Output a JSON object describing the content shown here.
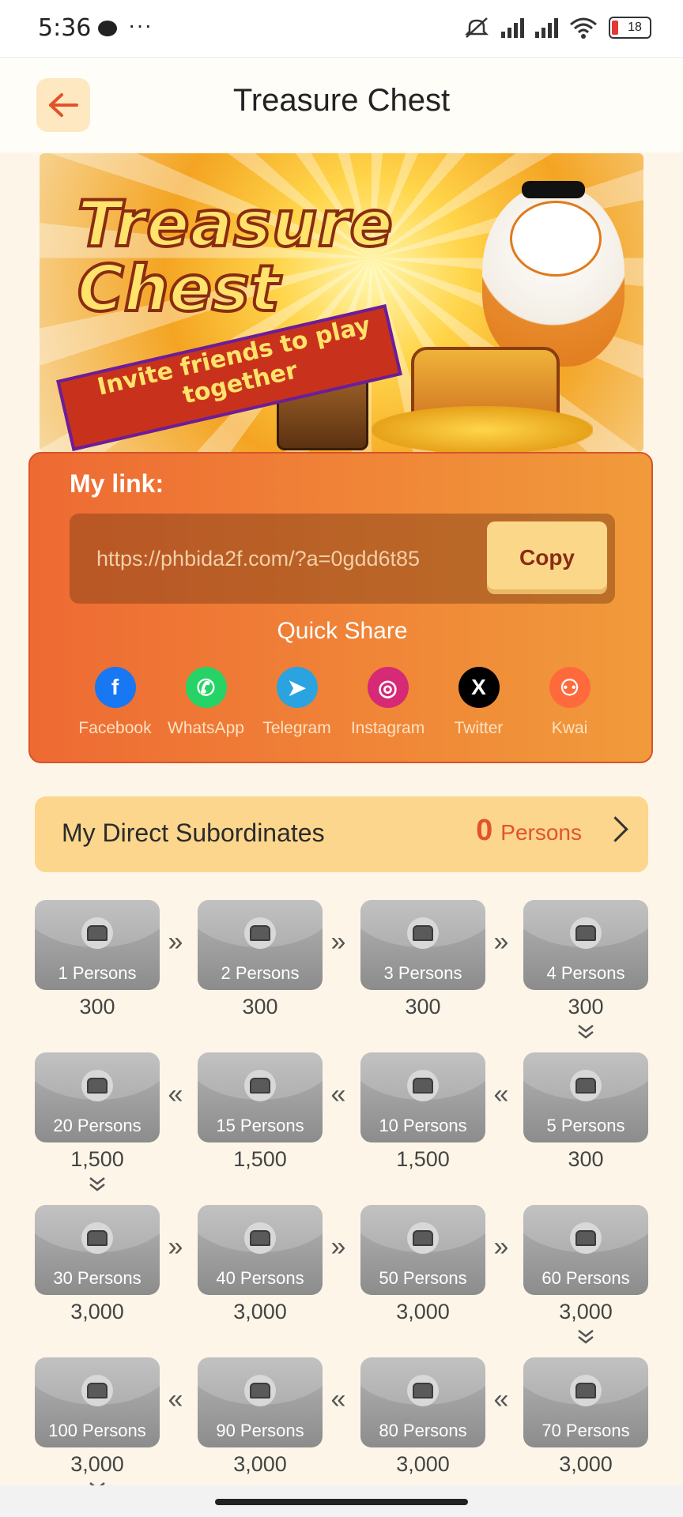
{
  "status_bar": {
    "time": "5:36",
    "battery": "18"
  },
  "header": {
    "title": "Treasure Chest"
  },
  "banner": {
    "title_line1": "Treasure",
    "title_line2": "Chest",
    "subtitle": "Invite friends to play together"
  },
  "link_card": {
    "label": "My link:",
    "url": "https://phbida2f.com/?a=0gdd6t85",
    "copy_label": "Copy",
    "quick_share_label": "Quick Share",
    "share_options": [
      {
        "name": "Facebook",
        "icon": "facebook-icon",
        "color": "#1877f2",
        "glyph": "f"
      },
      {
        "name": "WhatsApp",
        "icon": "whatsapp-icon",
        "color": "#25d366",
        "glyph": "✆"
      },
      {
        "name": "Telegram",
        "icon": "telegram-icon",
        "color": "#2aa3e0",
        "glyph": "➤"
      },
      {
        "name": "Instagram",
        "icon": "instagram-icon",
        "color": "#d62976",
        "glyph": "◎"
      },
      {
        "name": "Twitter",
        "icon": "x-icon",
        "color": "#000000",
        "glyph": "X"
      },
      {
        "name": "Kwai",
        "icon": "kwai-icon",
        "color": "#ff6a3d",
        "glyph": "⚇"
      }
    ]
  },
  "subordinates": {
    "label": "My Direct Subordinates",
    "count": "0",
    "unit": "Persons"
  },
  "rewards": [
    {
      "persons": "1 Persons",
      "amount": "300"
    },
    {
      "persons": "2 Persons",
      "amount": "300"
    },
    {
      "persons": "3 Persons",
      "amount": "300"
    },
    {
      "persons": "4 Persons",
      "amount": "300"
    },
    {
      "persons": "20 Persons",
      "amount": "1,500"
    },
    {
      "persons": "15 Persons",
      "amount": "1,500"
    },
    {
      "persons": "10 Persons",
      "amount": "1,500"
    },
    {
      "persons": "5 Persons",
      "amount": "300"
    },
    {
      "persons": "30 Persons",
      "amount": "3,000"
    },
    {
      "persons": "40 Persons",
      "amount": "3,000"
    },
    {
      "persons": "50 Persons",
      "amount": "3,000"
    },
    {
      "persons": "60 Persons",
      "amount": "3,000"
    },
    {
      "persons": "100 Persons",
      "amount": "3,000"
    },
    {
      "persons": "90 Persons",
      "amount": "3,000"
    },
    {
      "persons": "80 Persons",
      "amount": "3,000"
    },
    {
      "persons": "70 Persons",
      "amount": "3,000"
    }
  ]
}
